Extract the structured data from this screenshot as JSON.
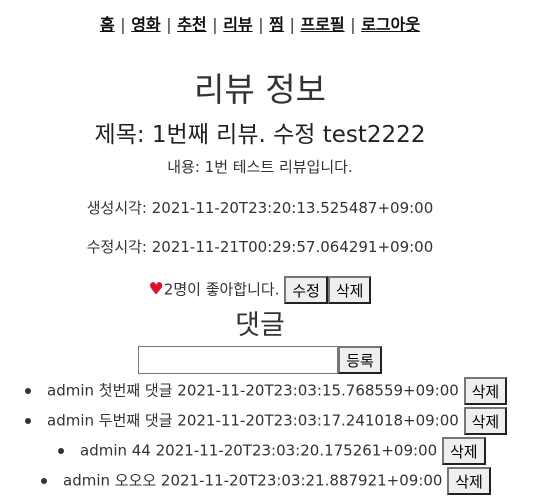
{
  "nav": {
    "items": [
      "홈",
      "영화",
      "추천",
      "리뷰",
      "찜",
      "프로필",
      "로그아웃"
    ],
    "separator": "|"
  },
  "page_title": "리뷰 정보",
  "review": {
    "title": "제목: 1번째 리뷰. 수정 test2222",
    "content": "내용: 1번 테스트 리뷰입니다.",
    "created": "생성시각: 2021-11-20T23:20:13.525487+09:00",
    "updated": "수정시각: 2021-11-21T00:29:57.064291+09:00",
    "heart": "♥",
    "likes_text": "2명이 좋아합니다.",
    "edit_label": "수정",
    "delete_label": "삭제"
  },
  "comments_section": {
    "title": "댓글",
    "input_value": "",
    "submit_label": "등록",
    "items": [
      {
        "text": "admin 첫번째 댓글 2021-11-20T23:03:15.768559+09:00",
        "delete_label": "삭제"
      },
      {
        "text": "admin 두번째 댓글 2021-11-20T23:03:17.241018+09:00",
        "delete_label": "삭제"
      },
      {
        "text": "admin 44 2021-11-20T23:03:20.175261+09:00",
        "delete_label": "삭제"
      },
      {
        "text": "admin 오오오 2021-11-20T23:03:21.887921+09:00",
        "delete_label": "삭제"
      }
    ]
  }
}
